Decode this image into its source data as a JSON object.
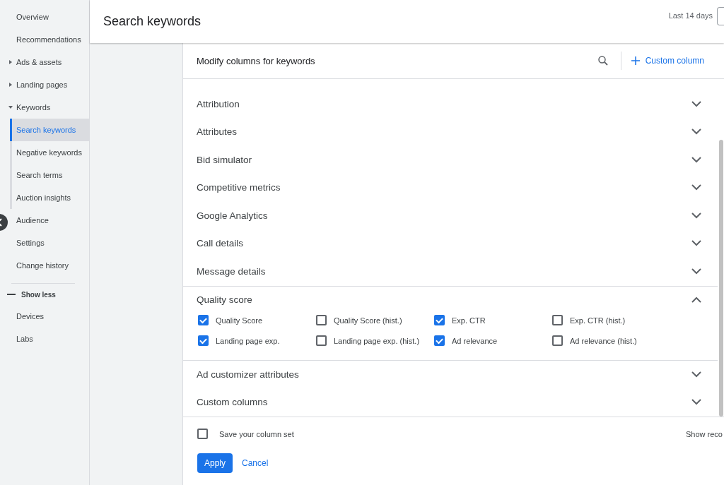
{
  "sidebar": {
    "items": [
      {
        "label": "Overview",
        "selected": false
      },
      {
        "label": "Recommendations",
        "selected": false
      },
      {
        "label": "Ads & assets",
        "selected": false,
        "expanded": false
      },
      {
        "label": "Landing pages",
        "selected": false,
        "expanded": false
      },
      {
        "label": "Keywords",
        "selected": false,
        "expanded": true,
        "children": [
          {
            "label": "Search keywords",
            "selected": true
          },
          {
            "label": "Negative keywords",
            "selected": false
          },
          {
            "label": "Search terms",
            "selected": false
          },
          {
            "label": "Auction insights",
            "selected": false
          }
        ]
      },
      {
        "label": "Audience",
        "selected": false
      },
      {
        "label": "Settings",
        "selected": false
      },
      {
        "label": "Change history",
        "selected": false
      }
    ],
    "show_less": "Show less",
    "more_items": [
      {
        "label": "Devices",
        "selected": false
      },
      {
        "label": "Labs",
        "selected": false
      }
    ]
  },
  "header": {
    "title": "Search keywords",
    "date_range": "Last 14 days"
  },
  "panel": {
    "title": "Modify columns for keywords",
    "custom_column": "Custom column",
    "sections": [
      {
        "label": "Attribution",
        "expanded": false
      },
      {
        "label": "Attributes",
        "expanded": false
      },
      {
        "label": "Bid simulator",
        "expanded": false
      },
      {
        "label": "Competitive metrics",
        "expanded": false
      },
      {
        "label": "Google Analytics",
        "expanded": false
      },
      {
        "label": "Call details",
        "expanded": false
      },
      {
        "label": "Message details",
        "expanded": false
      },
      {
        "label": "Quality score",
        "expanded": true,
        "options": [
          {
            "label": "Quality Score",
            "checked": true
          },
          {
            "label": "Quality Score (hist.)",
            "checked": false
          },
          {
            "label": "Exp. CTR",
            "checked": true
          },
          {
            "label": "Exp. CTR (hist.)",
            "checked": false
          },
          {
            "label": "Landing page exp.",
            "checked": true
          },
          {
            "label": "Landing page exp. (hist.)",
            "checked": false
          },
          {
            "label": "Ad relevance",
            "checked": true
          },
          {
            "label": "Ad relevance (hist.)",
            "checked": false
          }
        ]
      },
      {
        "label": "Ad customizer attributes",
        "expanded": false
      },
      {
        "label": "Custom columns",
        "expanded": false
      }
    ],
    "save_column_set": {
      "label": "Save your column set",
      "checked": false
    },
    "show_recommended": "Show reco",
    "apply": "Apply",
    "cancel": "Cancel"
  }
}
